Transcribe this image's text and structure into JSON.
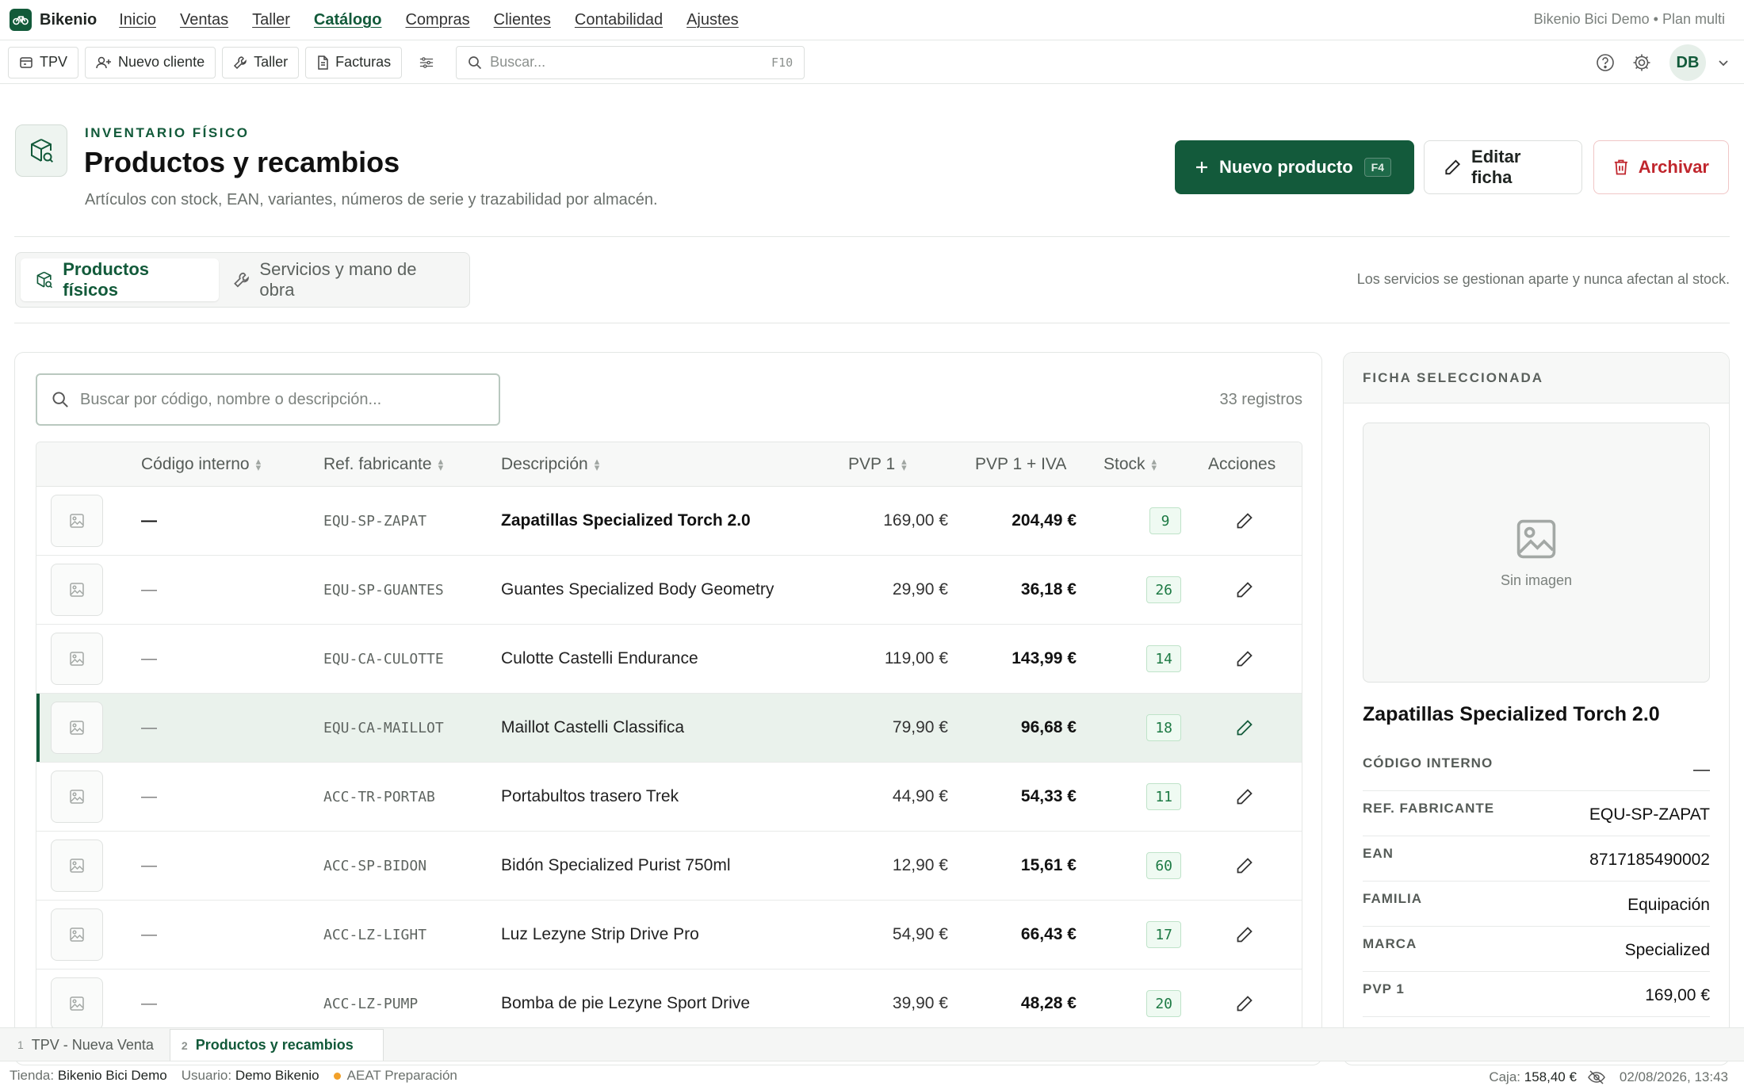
{
  "nav": {
    "brand": "Bikenio",
    "menu": [
      {
        "label": "Inicio",
        "active": false
      },
      {
        "label": "Ventas",
        "active": false
      },
      {
        "label": "Taller",
        "active": false
      },
      {
        "label": "Catálogo",
        "active": true
      },
      {
        "label": "Compras",
        "active": false
      },
      {
        "label": "Clientes",
        "active": false
      },
      {
        "label": "Contabilidad",
        "active": false
      },
      {
        "label": "Ajustes",
        "active": false
      }
    ],
    "tenant": "Bikenio Bici Demo • Plan multi"
  },
  "toolbar": {
    "tpv": "TPV",
    "new_client": "Nuevo cliente",
    "workshop": "Taller",
    "invoices": "Facturas",
    "search_placeholder": "Buscar...",
    "search_shortcut": "F10",
    "avatar": "DB"
  },
  "header": {
    "eyebrow": "INVENTARIO FÍSICO",
    "title": "Productos y recambios",
    "subtitle": "Artículos con stock, EAN, variantes, números de serie y trazabilidad por almacén.",
    "new_product": "Nuevo producto",
    "new_shortcut": "F4",
    "edit": "Editar ficha",
    "archive": "Archivar"
  },
  "tabs": {
    "physical": "Productos físicos",
    "services": "Servicios y mano de obra",
    "note": "Los servicios se gestionan aparte y nunca afectan al stock."
  },
  "list": {
    "search_placeholder": "Buscar por código, nombre o descripción...",
    "records": "33 registros",
    "columns": {
      "code": "Código interno",
      "ref": "Ref. fabricante",
      "desc": "Descripción",
      "pvp": "PVP 1",
      "pvp_iva": "PVP 1 + IVA",
      "stock": "Stock",
      "actions": "Acciones"
    },
    "rows": [
      {
        "code": "—",
        "ref": "EQU-SP-ZAPAT",
        "desc": "Zapatillas Specialized Torch 2.0",
        "pvp": "169,00 €",
        "pvp_iva": "204,49 €",
        "stock": "9"
      },
      {
        "code": "—",
        "ref": "EQU-SP-GUANTES",
        "desc": "Guantes Specialized Body Geometry",
        "pvp": "29,90 €",
        "pvp_iva": "36,18 €",
        "stock": "26"
      },
      {
        "code": "—",
        "ref": "EQU-CA-CULOTTE",
        "desc": "Culotte Castelli Endurance",
        "pvp": "119,00 €",
        "pvp_iva": "143,99 €",
        "stock": "14"
      },
      {
        "code": "—",
        "ref": "EQU-CA-MAILLOT",
        "desc": "Maillot Castelli Classifica",
        "pvp": "79,90 €",
        "pvp_iva": "96,68 €",
        "stock": "18"
      },
      {
        "code": "—",
        "ref": "ACC-TR-PORTAB",
        "desc": "Portabultos trasero Trek",
        "pvp": "44,90 €",
        "pvp_iva": "54,33 €",
        "stock": "11"
      },
      {
        "code": "—",
        "ref": "ACC-SP-BIDON",
        "desc": "Bidón Specialized Purist 750ml",
        "pvp": "12,90 €",
        "pvp_iva": "15,61 €",
        "stock": "60"
      },
      {
        "code": "—",
        "ref": "ACC-LZ-LIGHT",
        "desc": "Luz Lezyne Strip Drive Pro",
        "pvp": "54,90 €",
        "pvp_iva": "66,43 €",
        "stock": "17"
      },
      {
        "code": "—",
        "ref": "ACC-LZ-PUMP",
        "desc": "Bomba de pie Lezyne Sport Drive",
        "pvp": "39,90 €",
        "pvp_iva": "48,28 €",
        "stock": "20"
      }
    ]
  },
  "detail": {
    "heading": "FICHA SELECCIONADA",
    "no_image": "Sin imagen",
    "name": "Zapatillas Specialized Torch 2.0",
    "fields": [
      {
        "label": "CÓDIGO INTERNO",
        "value": "—"
      },
      {
        "label": "REF. FABRICANTE",
        "value": "EQU-SP-ZAPAT"
      },
      {
        "label": "EAN",
        "value": "8717185490002"
      },
      {
        "label": "FAMILIA",
        "value": "Equipación"
      },
      {
        "label": "MARCA",
        "value": "Specialized"
      },
      {
        "label": "PVP 1",
        "value": "169,00 €"
      }
    ]
  },
  "window_tabs": [
    {
      "num": "1",
      "label": "TPV - Nueva Venta"
    },
    {
      "num": "2",
      "label": "Productos y recambios"
    }
  ],
  "status": {
    "store_label": "Tienda:",
    "store": "Bikenio Bici Demo",
    "user_label": "Usuario:",
    "user": "Demo Bikenio",
    "aeat": "AEAT Preparación",
    "cash_label": "Caja:",
    "cash": "158,40 €",
    "datetime": "02/08/2026, 13:43"
  },
  "colors": {
    "brand": "#125a3a",
    "danger": "#c0262d",
    "stock_badge": "#1d7a44",
    "aeat_dot": "#f2a12a"
  }
}
